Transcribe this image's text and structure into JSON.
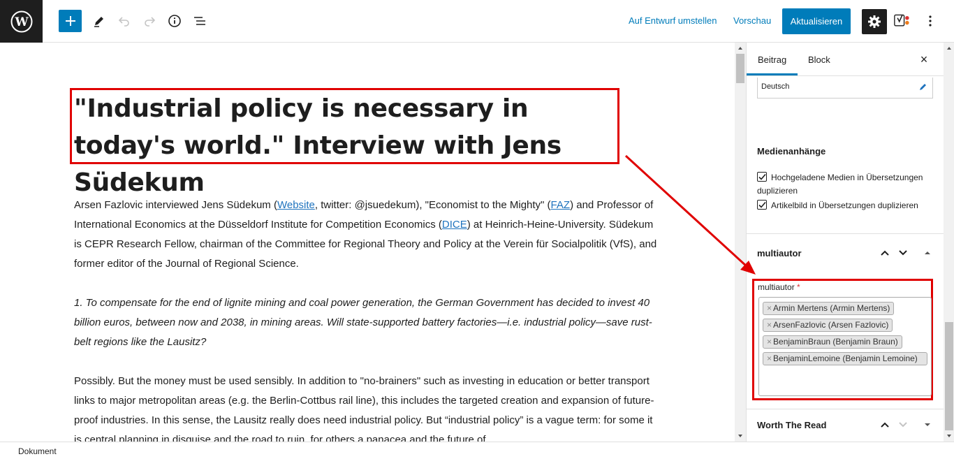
{
  "toolbar": {
    "switch_to_draft": "Auf Entwurf umstellen",
    "preview": "Vorschau",
    "update": "Aktualisieren",
    "icons": [
      "wordpress-icon",
      "plus-icon",
      "pencil-icon",
      "undo-icon",
      "redo-icon",
      "info-icon",
      "list-view-icon",
      "gear-icon",
      "yoast-icon",
      "more-vertical-icon"
    ]
  },
  "post": {
    "title": "\"Industrial policy is necessary in today's world.\" Interview with Jens Südekum",
    "intro_a": "Arsen Fazlovic interviewed Jens Südekum (",
    "intro_link_website": "Website",
    "intro_b": ", twitter: @jsuedekum), \"Economist to the Mighty\" (",
    "intro_link_faz": "FAZ",
    "intro_c": ") and Professor of International Economics at the Düsseldorf Institute for Competition Economics (",
    "intro_link_dice": "DICE",
    "intro_d": ") at Heinrich-Heine-University. Südekum is CEPR Research Fellow, chairman of the Committee for Regional Theory and Policy at the Verein für Socialpolitik (VfS), and former editor of the Journal of Regional Science.",
    "question_1": "1. To compensate for the end of lignite mining and coal power generation, the German Government has decided to invest 40 billion euros, between now and 2038, in mining areas. Will state-supported battery factories—i.e. industrial policy—save rust-belt regions like the Lausitz?",
    "answer_1": "Possibly. But the money must be used sensibly. In addition to \"no-brainers\" such as investing in education or better transport links to major metropolitan areas (e.g. the Berlin-Cottbus rail line), this includes the targeted creation and expansion of future-proof industries. In this sense, the Lausitz really does need industrial policy. But “industrial policy” is a vague term: for some it is central planning in disguise and the road to ruin, for others a panacea and the future of"
  },
  "sidebar": {
    "tab_post": "Beitrag",
    "tab_block": "Block",
    "close": "×",
    "language_value": "Deutsch",
    "media_heading": "Medienanhänge",
    "media_option_1": "Hochgeladene Medien in Übersetzungen duplizieren",
    "media_option_2": "Artikelbild in Übersetzungen duplizieren",
    "multiautor_heading": "multiautor",
    "multiautor_label": "multiautor",
    "required_mark": "*",
    "authors": [
      "Armin Mertens (Armin Mertens)",
      "ArsenFazlovic (Arsen Fazlovic)",
      "BenjaminBraun (Benjamin Braun)",
      "BenjaminLemoine (Benjamin Lemoine)"
    ],
    "worth_heading": "Worth The Read"
  },
  "footer": {
    "label": "Dokument"
  },
  "colors": {
    "accent": "#007cba",
    "highlight": "#e00000",
    "dark": "#1e1e1e"
  }
}
